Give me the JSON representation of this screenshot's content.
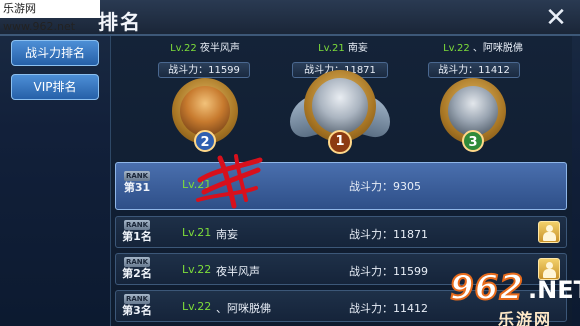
{
  "site": {
    "label": "乐游网 www.962.net"
  },
  "header": {
    "title": "排名",
    "close": "✕"
  },
  "sidebar": {
    "power_rank_label": "战斗力排名",
    "vip_rank_label": "VIP排名"
  },
  "podium": [
    {
      "rank": "1",
      "level": "Lv.21",
      "name": "南妄",
      "power": "战斗力：11871"
    },
    {
      "rank": "2",
      "level": "Lv.22",
      "name": "夜半风声",
      "power": "战斗力：11599"
    },
    {
      "rank": "3",
      "level": "Lv.22",
      "name": "、阿咪脱佛",
      "power": "战斗力：11412"
    }
  ],
  "rank_header": "RANK",
  "my_row": {
    "place": "第31",
    "level": "Lv.21",
    "power": "战斗力：9305"
  },
  "rows": [
    {
      "place": "第1名",
      "level": "Lv.21",
      "name": "南妄",
      "power": "战斗力：11871"
    },
    {
      "place": "第2名",
      "level": "Lv.22",
      "name": "夜半风声",
      "power": "战斗力：11599"
    },
    {
      "place": "第3名",
      "level": "Lv.22",
      "name": "、阿咪脱佛",
      "power": "战斗力：11412"
    }
  ],
  "watermark": {
    "number": "962",
    "suffix": ".NET",
    "brand": "乐游网"
  },
  "colors": {
    "level_green": "#7ddc3a",
    "highlight_row": "#3b5f9c",
    "scribble_red": "#d8101c",
    "gold": "#d9a441"
  }
}
